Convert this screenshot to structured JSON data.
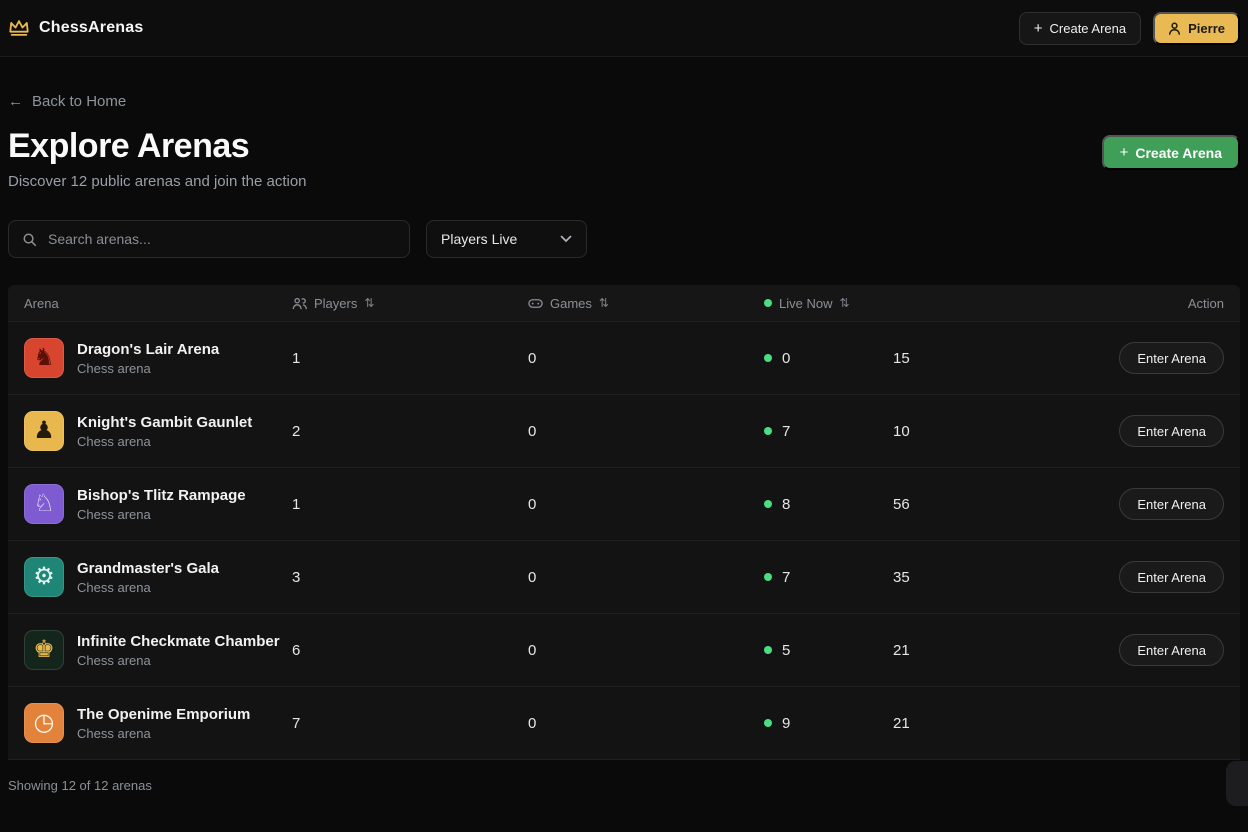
{
  "header": {
    "brand": "ChessArenas",
    "create_arena_label": "Create Arena",
    "user_label": "Pierre"
  },
  "icons": {
    "plus": "+",
    "back_arrow": "←",
    "sort": "⇅"
  },
  "colors": {
    "accent_green": "#3f9e57",
    "accent_yellow": "#e9b954",
    "live_dot": "#4ade80"
  },
  "page": {
    "back_link": "Back to Home",
    "title": "Explore Arenas",
    "subtitle": "Discover 12 public arenas and join the action",
    "create_arena_label": "Create Arena",
    "footer": "Showing 12 of 12 arenas"
  },
  "search": {
    "placeholder": "Search arenas...",
    "filter_value": "Players Live"
  },
  "table": {
    "headers": {
      "arena": "Arena",
      "players": "Players",
      "games": "Games",
      "live": "Live Now",
      "action": "Action"
    },
    "rows": [
      {
        "name": "Dragon's Lair Arena",
        "sub": "Chess arena",
        "players": "1",
        "games": "0",
        "live": "0",
        "rating": "15",
        "action": "Enter Arena",
        "icon_glyph": "♞",
        "tile_bg": "#d8452e",
        "tile_fg": "#5c1008"
      },
      {
        "name": "Knight's Gambit Gaunlet",
        "sub": "Chess arena",
        "players": "2",
        "games": "0",
        "live": "7",
        "rating": "10",
        "action": "Enter Arena",
        "icon_glyph": "♟",
        "tile_bg": "#e8b84e",
        "tile_fg": "#221c10"
      },
      {
        "name": "Bishop's Tlitz Rampage",
        "sub": "Chess arena",
        "players": "1",
        "games": "0",
        "live": "8",
        "rating": "56",
        "action": "Enter Arena",
        "icon_glyph": "♘",
        "tile_bg": "#7e5bd0",
        "tile_fg": "#f4efff"
      },
      {
        "name": "Grandmaster's Gala",
        "sub": "Chess arena",
        "players": "3",
        "games": "0",
        "live": "7",
        "rating": "35",
        "action": "Enter Arena",
        "icon_glyph": "⚙",
        "tile_bg": "#1f8577",
        "tile_fg": "#dcf4ec"
      },
      {
        "name": "Infinite Checkmate Chamber",
        "sub": "Chess arena",
        "players": "6",
        "games": "0",
        "live": "5",
        "rating": "21",
        "action": "Enter Arena",
        "icon_glyph": "♚",
        "tile_bg": "#14261c",
        "tile_fg": "#e8b84e"
      },
      {
        "name": "The Openime Emporium",
        "sub": "Chess arena",
        "players": "7",
        "games": "0",
        "live": "9",
        "rating": "21",
        "action": null,
        "icon_glyph": "◷",
        "tile_bg": "#e2823b",
        "tile_fg": "#fff6e8"
      }
    ]
  }
}
